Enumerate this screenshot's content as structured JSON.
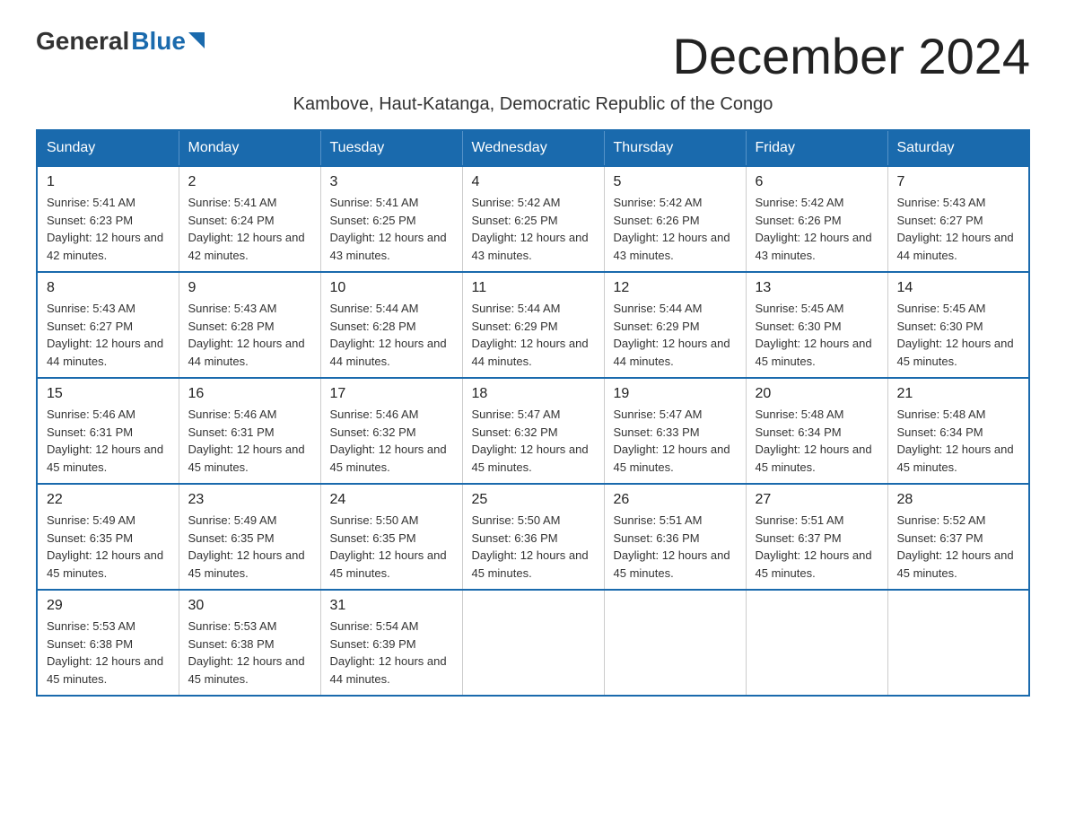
{
  "logo": {
    "general": "General",
    "blue": "Blue"
  },
  "title": "December 2024",
  "subtitle": "Kambove, Haut-Katanga, Democratic Republic of the Congo",
  "days_of_week": [
    "Sunday",
    "Monday",
    "Tuesday",
    "Wednesday",
    "Thursday",
    "Friday",
    "Saturday"
  ],
  "weeks": [
    [
      {
        "day": "1",
        "sunrise": "Sunrise: 5:41 AM",
        "sunset": "Sunset: 6:23 PM",
        "daylight": "Daylight: 12 hours and 42 minutes."
      },
      {
        "day": "2",
        "sunrise": "Sunrise: 5:41 AM",
        "sunset": "Sunset: 6:24 PM",
        "daylight": "Daylight: 12 hours and 42 minutes."
      },
      {
        "day": "3",
        "sunrise": "Sunrise: 5:41 AM",
        "sunset": "Sunset: 6:25 PM",
        "daylight": "Daylight: 12 hours and 43 minutes."
      },
      {
        "day": "4",
        "sunrise": "Sunrise: 5:42 AM",
        "sunset": "Sunset: 6:25 PM",
        "daylight": "Daylight: 12 hours and 43 minutes."
      },
      {
        "day": "5",
        "sunrise": "Sunrise: 5:42 AM",
        "sunset": "Sunset: 6:26 PM",
        "daylight": "Daylight: 12 hours and 43 minutes."
      },
      {
        "day": "6",
        "sunrise": "Sunrise: 5:42 AM",
        "sunset": "Sunset: 6:26 PM",
        "daylight": "Daylight: 12 hours and 43 minutes."
      },
      {
        "day": "7",
        "sunrise": "Sunrise: 5:43 AM",
        "sunset": "Sunset: 6:27 PM",
        "daylight": "Daylight: 12 hours and 44 minutes."
      }
    ],
    [
      {
        "day": "8",
        "sunrise": "Sunrise: 5:43 AM",
        "sunset": "Sunset: 6:27 PM",
        "daylight": "Daylight: 12 hours and 44 minutes."
      },
      {
        "day": "9",
        "sunrise": "Sunrise: 5:43 AM",
        "sunset": "Sunset: 6:28 PM",
        "daylight": "Daylight: 12 hours and 44 minutes."
      },
      {
        "day": "10",
        "sunrise": "Sunrise: 5:44 AM",
        "sunset": "Sunset: 6:28 PM",
        "daylight": "Daylight: 12 hours and 44 minutes."
      },
      {
        "day": "11",
        "sunrise": "Sunrise: 5:44 AM",
        "sunset": "Sunset: 6:29 PM",
        "daylight": "Daylight: 12 hours and 44 minutes."
      },
      {
        "day": "12",
        "sunrise": "Sunrise: 5:44 AM",
        "sunset": "Sunset: 6:29 PM",
        "daylight": "Daylight: 12 hours and 44 minutes."
      },
      {
        "day": "13",
        "sunrise": "Sunrise: 5:45 AM",
        "sunset": "Sunset: 6:30 PM",
        "daylight": "Daylight: 12 hours and 45 minutes."
      },
      {
        "day": "14",
        "sunrise": "Sunrise: 5:45 AM",
        "sunset": "Sunset: 6:30 PM",
        "daylight": "Daylight: 12 hours and 45 minutes."
      }
    ],
    [
      {
        "day": "15",
        "sunrise": "Sunrise: 5:46 AM",
        "sunset": "Sunset: 6:31 PM",
        "daylight": "Daylight: 12 hours and 45 minutes."
      },
      {
        "day": "16",
        "sunrise": "Sunrise: 5:46 AM",
        "sunset": "Sunset: 6:31 PM",
        "daylight": "Daylight: 12 hours and 45 minutes."
      },
      {
        "day": "17",
        "sunrise": "Sunrise: 5:46 AM",
        "sunset": "Sunset: 6:32 PM",
        "daylight": "Daylight: 12 hours and 45 minutes."
      },
      {
        "day": "18",
        "sunrise": "Sunrise: 5:47 AM",
        "sunset": "Sunset: 6:32 PM",
        "daylight": "Daylight: 12 hours and 45 minutes."
      },
      {
        "day": "19",
        "sunrise": "Sunrise: 5:47 AM",
        "sunset": "Sunset: 6:33 PM",
        "daylight": "Daylight: 12 hours and 45 minutes."
      },
      {
        "day": "20",
        "sunrise": "Sunrise: 5:48 AM",
        "sunset": "Sunset: 6:34 PM",
        "daylight": "Daylight: 12 hours and 45 minutes."
      },
      {
        "day": "21",
        "sunrise": "Sunrise: 5:48 AM",
        "sunset": "Sunset: 6:34 PM",
        "daylight": "Daylight: 12 hours and 45 minutes."
      }
    ],
    [
      {
        "day": "22",
        "sunrise": "Sunrise: 5:49 AM",
        "sunset": "Sunset: 6:35 PM",
        "daylight": "Daylight: 12 hours and 45 minutes."
      },
      {
        "day": "23",
        "sunrise": "Sunrise: 5:49 AM",
        "sunset": "Sunset: 6:35 PM",
        "daylight": "Daylight: 12 hours and 45 minutes."
      },
      {
        "day": "24",
        "sunrise": "Sunrise: 5:50 AM",
        "sunset": "Sunset: 6:35 PM",
        "daylight": "Daylight: 12 hours and 45 minutes."
      },
      {
        "day": "25",
        "sunrise": "Sunrise: 5:50 AM",
        "sunset": "Sunset: 6:36 PM",
        "daylight": "Daylight: 12 hours and 45 minutes."
      },
      {
        "day": "26",
        "sunrise": "Sunrise: 5:51 AM",
        "sunset": "Sunset: 6:36 PM",
        "daylight": "Daylight: 12 hours and 45 minutes."
      },
      {
        "day": "27",
        "sunrise": "Sunrise: 5:51 AM",
        "sunset": "Sunset: 6:37 PM",
        "daylight": "Daylight: 12 hours and 45 minutes."
      },
      {
        "day": "28",
        "sunrise": "Sunrise: 5:52 AM",
        "sunset": "Sunset: 6:37 PM",
        "daylight": "Daylight: 12 hours and 45 minutes."
      }
    ],
    [
      {
        "day": "29",
        "sunrise": "Sunrise: 5:53 AM",
        "sunset": "Sunset: 6:38 PM",
        "daylight": "Daylight: 12 hours and 45 minutes."
      },
      {
        "day": "30",
        "sunrise": "Sunrise: 5:53 AM",
        "sunset": "Sunset: 6:38 PM",
        "daylight": "Daylight: 12 hours and 45 minutes."
      },
      {
        "day": "31",
        "sunrise": "Sunrise: 5:54 AM",
        "sunset": "Sunset: 6:39 PM",
        "daylight": "Daylight: 12 hours and 44 minutes."
      },
      null,
      null,
      null,
      null
    ]
  ]
}
